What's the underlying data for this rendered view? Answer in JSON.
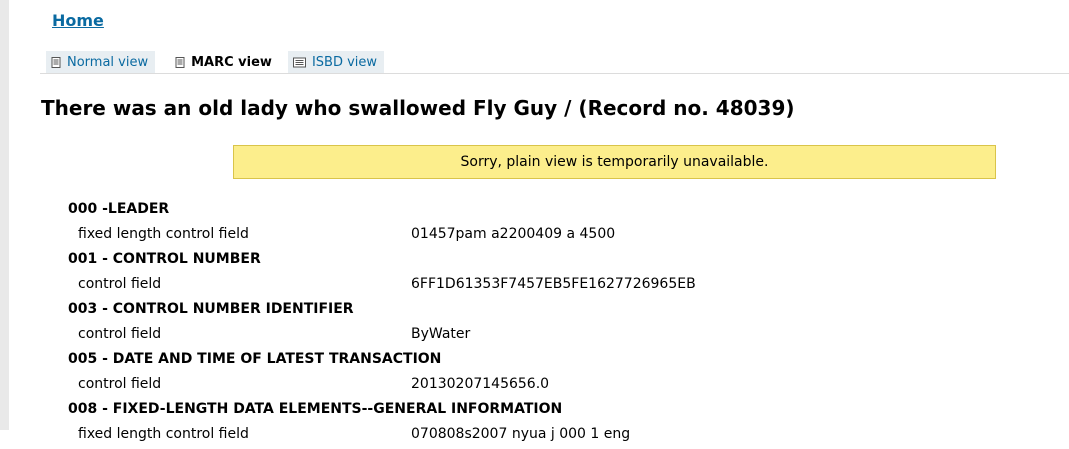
{
  "nav": {
    "home_label": "Home"
  },
  "tabs": [
    {
      "label": "Normal view",
      "active": false,
      "icon": "document-icon"
    },
    {
      "label": "MARC view",
      "active": true,
      "icon": "document-icon"
    },
    {
      "label": "ISBD view",
      "active": false,
      "icon": "list-card-icon"
    }
  ],
  "record": {
    "title": "There was an old lady who swallowed Fly Guy / (Record no. 48039)"
  },
  "alert": {
    "message": "Sorry, plain view is temporarily unavailable."
  },
  "marc_fields": [
    {
      "tag": "000 -LEADER",
      "label": "fixed length control field",
      "value": "01457pam a2200409 a 4500"
    },
    {
      "tag": "001 - CONTROL NUMBER",
      "label": "control field",
      "value": "6FF1D61353F7457EB5FE1627726965EB"
    },
    {
      "tag": "003 - CONTROL NUMBER IDENTIFIER",
      "label": "control field",
      "value": "ByWater"
    },
    {
      "tag": "005 - DATE AND TIME OF LATEST TRANSACTION",
      "label": "control field",
      "value": "20130207145656.0"
    },
    {
      "tag": "008 - FIXED-LENGTH DATA ELEMENTS--GENERAL INFORMATION",
      "label": "fixed length control field",
      "value": "070808s2007 nyua j 000 1 eng"
    }
  ],
  "colors": {
    "link": "#0a6aa1",
    "alert_bg": "#fcee8c",
    "alert_border": "#d9c44a",
    "tab_bg": "#e8eef2"
  }
}
